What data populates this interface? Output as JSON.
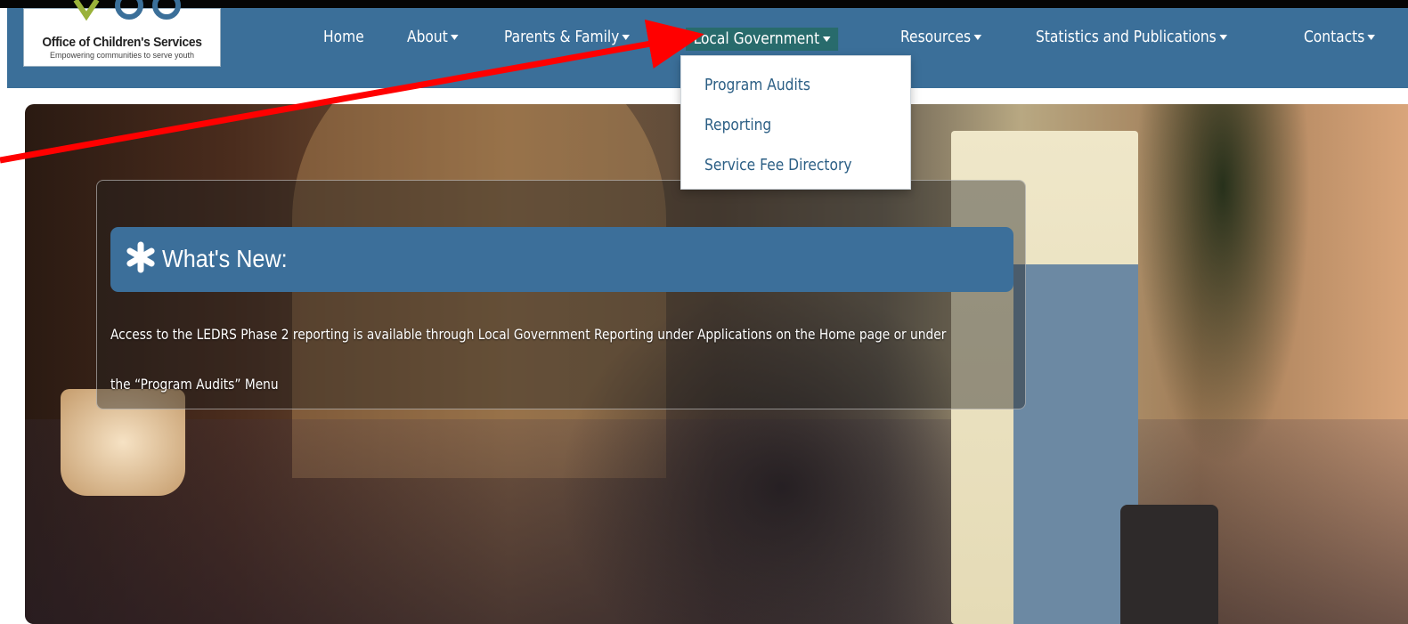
{
  "logo": {
    "title": "Office of Children's Services",
    "tagline": "Empowering communities to serve youth"
  },
  "nav": {
    "items": [
      {
        "label": "Home",
        "has_caret": false
      },
      {
        "label": "About",
        "has_caret": true
      },
      {
        "label": "Parents & Family",
        "has_caret": true
      },
      {
        "label": "Local Government",
        "has_caret": true,
        "active": true
      },
      {
        "label": "Resources",
        "has_caret": true
      },
      {
        "label": "Statistics and Publications",
        "has_caret": true
      },
      {
        "label": "Contacts",
        "has_caret": true
      }
    ]
  },
  "dropdown": {
    "items": [
      "Program Audits",
      "Reporting",
      "Service Fee Directory"
    ]
  },
  "news": {
    "title": "What's New:",
    "body": "Access to the LEDRS Phase 2 reporting is available through Local Government Reporting under Applications on the Home page or under the “Program Audits” Menu"
  },
  "colors": {
    "navbar": "#3b6f99",
    "active_nav": "#286b6c",
    "annotation_arrow": "#ff0000"
  }
}
